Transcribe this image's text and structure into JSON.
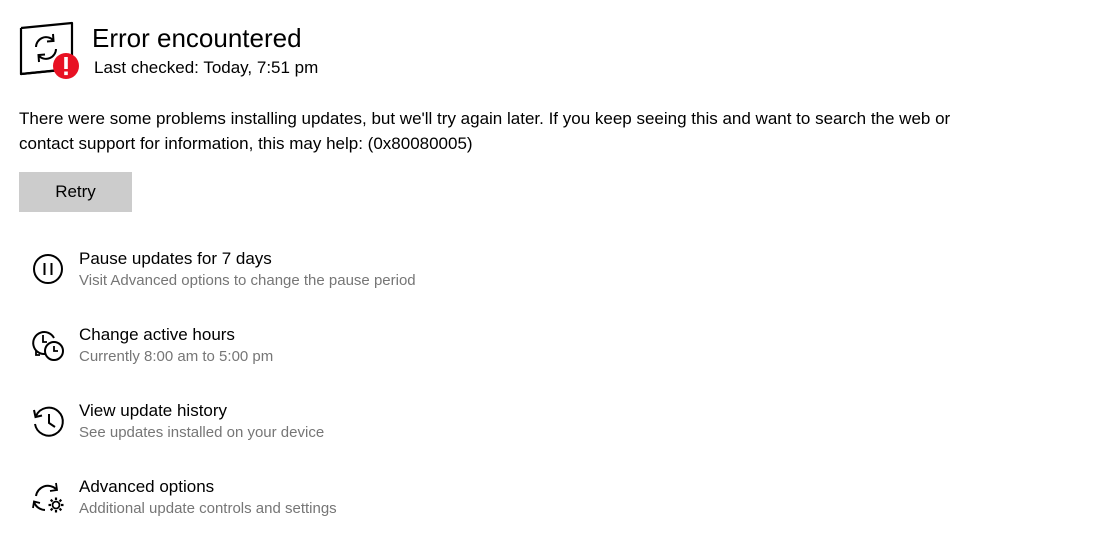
{
  "status": {
    "title": "Error encountered",
    "last_checked": "Last checked: Today, 7:51 pm",
    "icon": "update-error-icon",
    "error_color": "#e81123"
  },
  "message": "There were some problems installing updates, but we'll try again later. If you keep seeing this and want to search the web or contact support for information, this may help: (0x80080005)",
  "retry_label": "Retry",
  "options": [
    {
      "label": "Pause updates for 7 days",
      "description": "Visit Advanced options to change the pause period",
      "icon": "pause-icon"
    },
    {
      "label": "Change active hours",
      "description": "Currently 8:00 am to 5:00 pm",
      "icon": "active-hours-icon"
    },
    {
      "label": "View update history",
      "description": "See updates installed on your device",
      "icon": "history-icon"
    },
    {
      "label": "Advanced options",
      "description": "Additional update controls and settings",
      "icon": "advanced-options-icon"
    }
  ]
}
